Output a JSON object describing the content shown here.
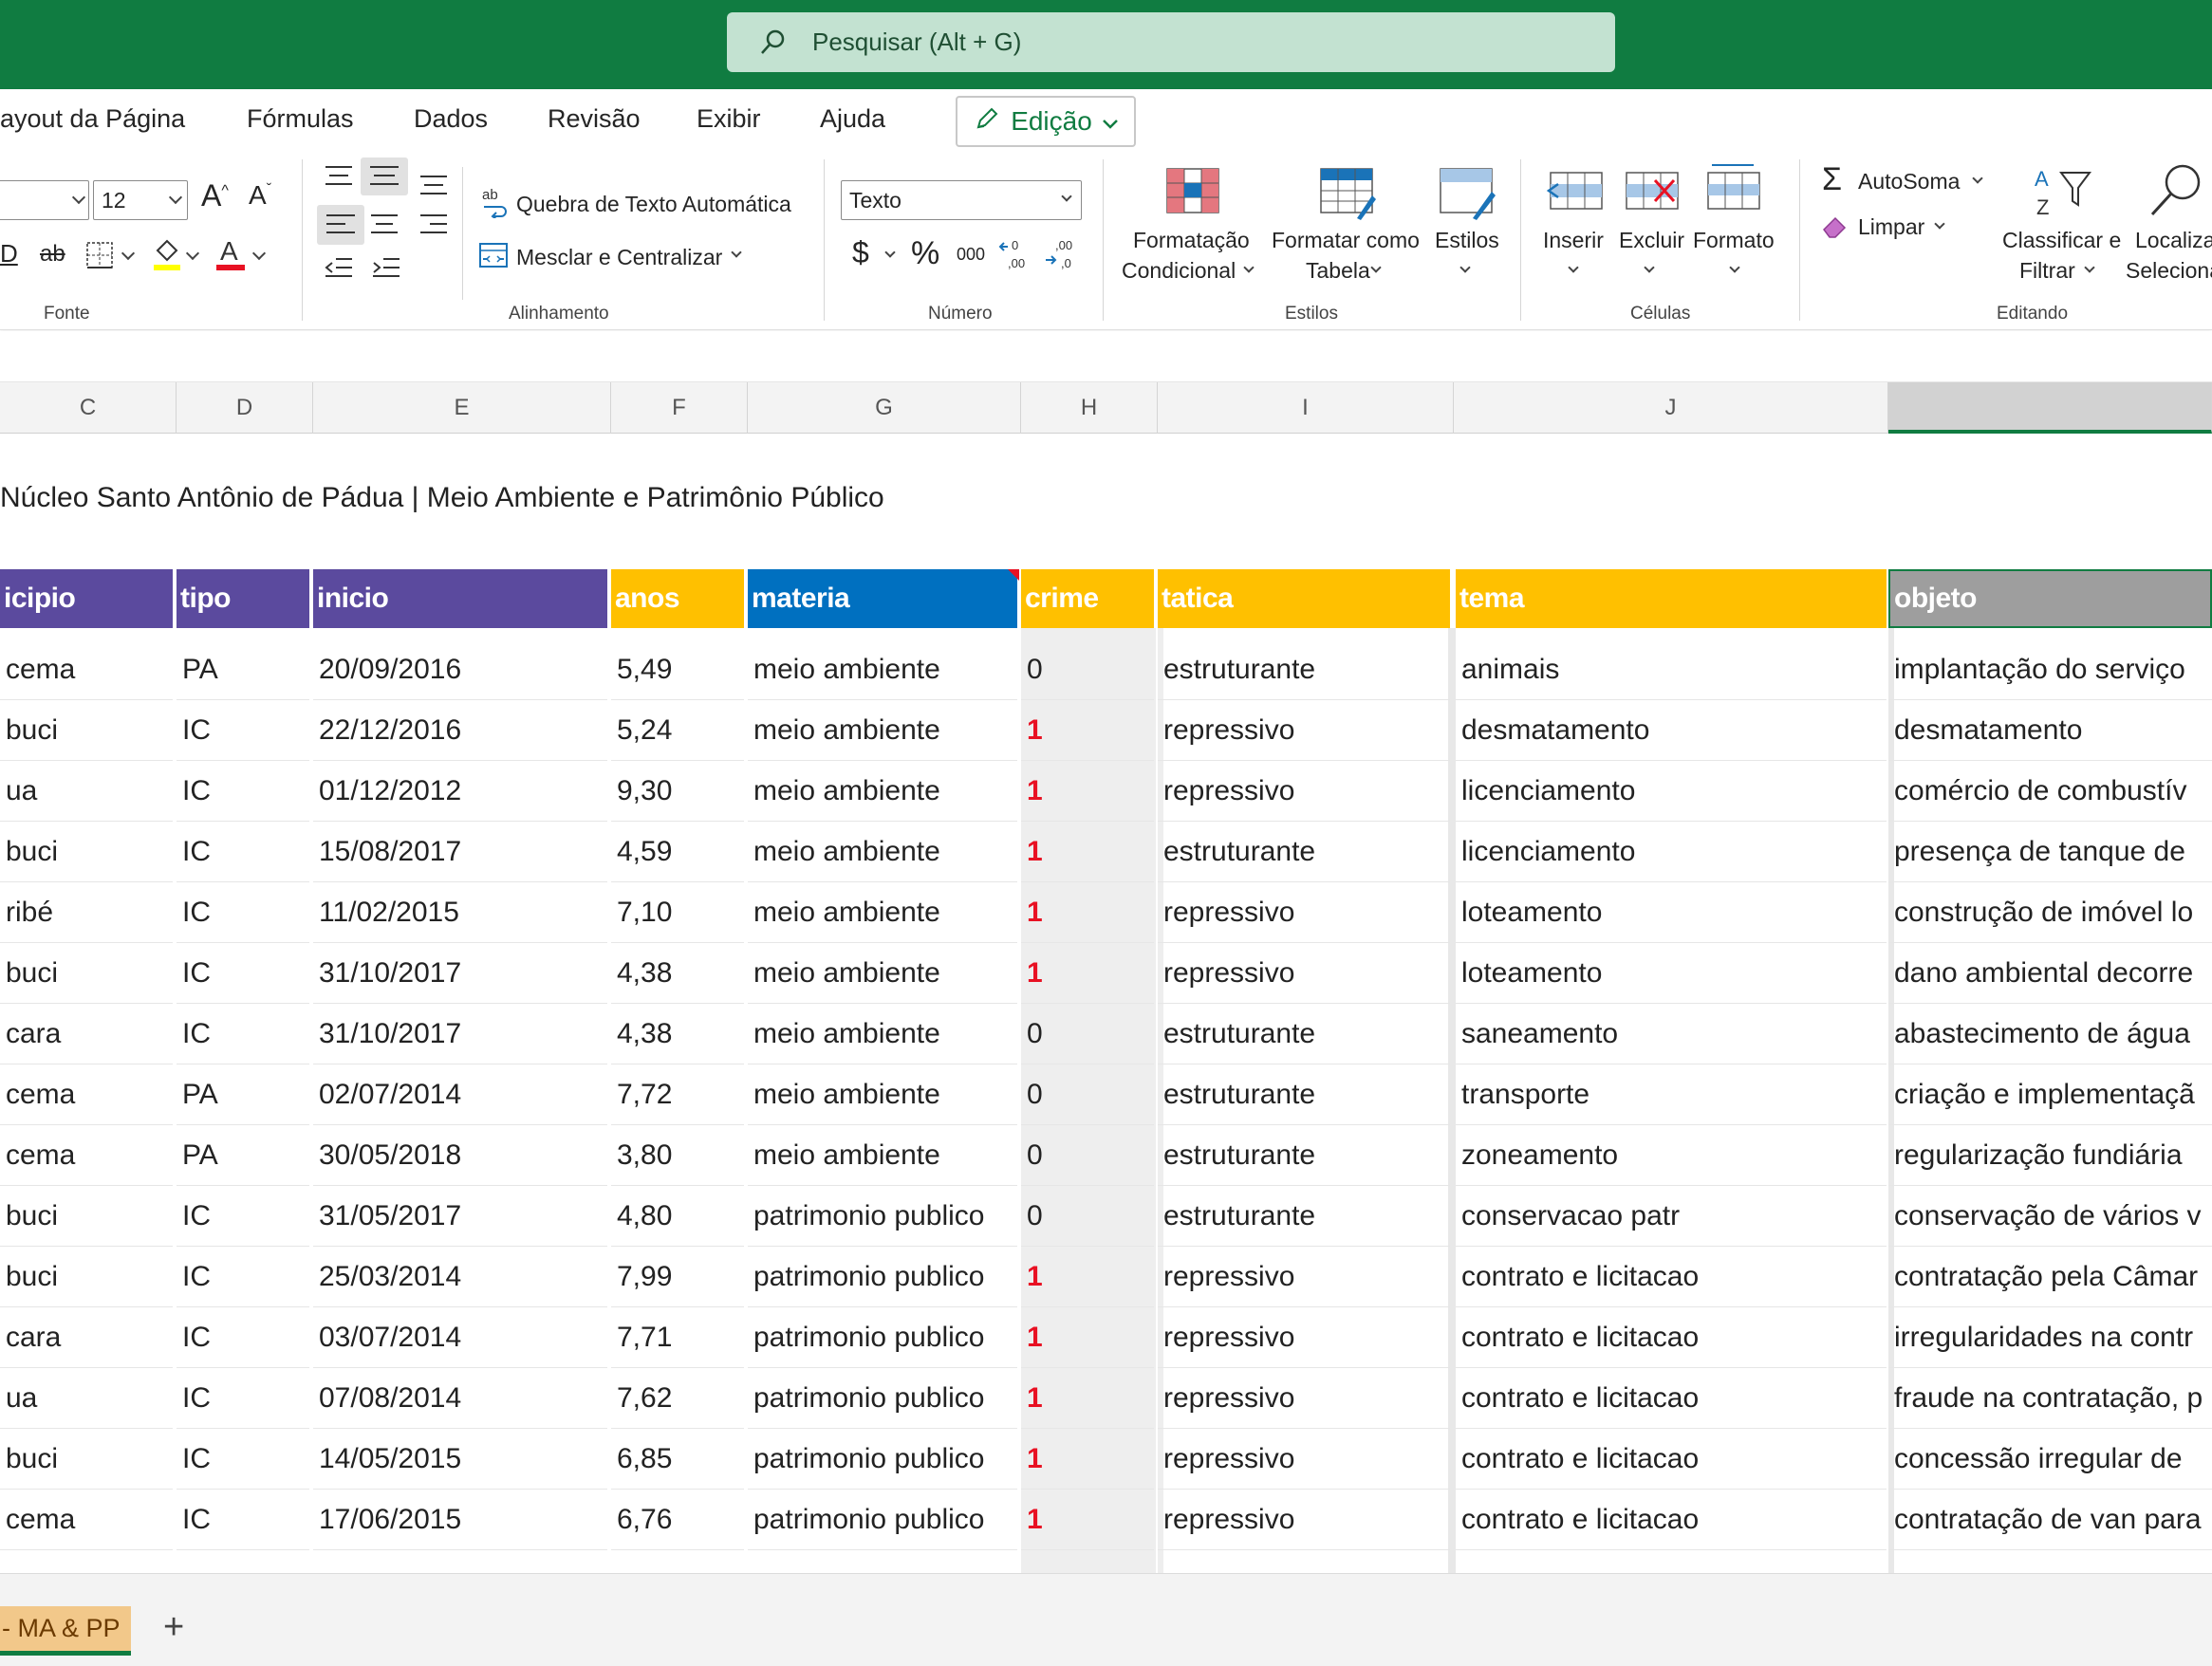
{
  "search": {
    "placeholder": "Pesquisar (Alt + G)"
  },
  "menu": {
    "items": [
      "ayout da Página",
      "Fórmulas",
      "Dados",
      "Revisão",
      "Exibir",
      "Ajuda"
    ],
    "mode_label": "Edição"
  },
  "ribbon": {
    "font": {
      "size": "12",
      "label": "Fonte",
      "grow_glyph": "A^",
      "shrink_glyph": "Aˇ"
    },
    "alignment": {
      "wrap_label": "Quebra de Texto Automática",
      "merge_label": "Mesclar e Centralizar",
      "label": "Alinhamento"
    },
    "number": {
      "format": "Texto",
      "currency": "$",
      "percent": "%",
      "thousands": "000",
      "label": "Número"
    },
    "styles": {
      "conditional_line1": "Formatação",
      "conditional_line2": "Condicional",
      "table_line1": "Formatar como",
      "table_line2": "Tabela",
      "styles": "Estilos",
      "label": "Estilos"
    },
    "cells": {
      "insert": "Inserir",
      "delete": "Excluir",
      "format": "Formato",
      "label": "Células"
    },
    "editing": {
      "autosum": "AutoSoma",
      "clear": "Limpar",
      "sort_line1": "Classificar e",
      "sort_line2": "Filtrar",
      "find_line1": "Localiza",
      "find_line2": "Seleciona",
      "label": "Editando"
    }
  },
  "columns": [
    "C",
    "D",
    "E",
    "F",
    "G",
    "H",
    "I",
    "J"
  ],
  "sheet_title": "Núcleo Santo Antônio de Pádua |  Meio Ambiente e Patrimônio Público",
  "headers": {
    "municipio": "icipio",
    "tipo": "tipo",
    "inicio": "inicio",
    "anos": "anos",
    "materia": "materia",
    "crime": "crime",
    "tatica": "tatica",
    "tema": "tema",
    "objeto": "objeto"
  },
  "header_colors": {
    "purple": "#5b4a9e",
    "yellow": "#ffc000",
    "blue": "#0070c0",
    "grey": "#9e9e9e"
  },
  "rows": [
    [
      "cema",
      "PA",
      "20/09/2016",
      "5,49",
      "meio ambiente",
      "0",
      "estruturante",
      "animais",
      "implantação do serviço"
    ],
    [
      "buci",
      "IC",
      "22/12/2016",
      "5,24",
      "meio ambiente",
      "1",
      "repressivo",
      "desmatamento",
      "desmatamento"
    ],
    [
      "ua",
      "IC",
      "01/12/2012",
      "9,30",
      "meio ambiente",
      "1",
      "repressivo",
      "licenciamento",
      "comércio de combustív"
    ],
    [
      "buci",
      "IC",
      "15/08/2017",
      "4,59",
      "meio ambiente",
      "1",
      "estruturante",
      "licenciamento",
      "presença de tanque de"
    ],
    [
      "ribé",
      "IC",
      "11/02/2015",
      "7,10",
      "meio ambiente",
      "1",
      "repressivo",
      "loteamento",
      "construção de imóvel lo"
    ],
    [
      "buci",
      "IC",
      "31/10/2017",
      "4,38",
      "meio ambiente",
      "1",
      "repressivo",
      "loteamento",
      "dano ambiental decorre"
    ],
    [
      "cara",
      "IC",
      "31/10/2017",
      "4,38",
      "meio ambiente",
      "0",
      "estruturante",
      "saneamento",
      "abastecimento de água"
    ],
    [
      "cema",
      "PA",
      "02/07/2014",
      "7,72",
      "meio ambiente",
      "0",
      "estruturante",
      "transporte",
      "criação e implementaçã"
    ],
    [
      "cema",
      "PA",
      "30/05/2018",
      "3,80",
      "meio ambiente",
      "0",
      "estruturante",
      "zoneamento",
      "regularização fundiária"
    ],
    [
      "buci",
      "IC",
      "31/05/2017",
      "4,80",
      "patrimonio publico",
      "0",
      "estruturante",
      "conservacao patr",
      "conservação de vários v"
    ],
    [
      "buci",
      "IC",
      "25/03/2014",
      "7,99",
      "patrimonio publico",
      "1",
      "repressivo",
      "contrato e licitacao",
      "contratação pela Câmar"
    ],
    [
      "cara",
      "IC",
      "03/07/2014",
      "7,71",
      "patrimonio publico",
      "1",
      "repressivo",
      "contrato e licitacao",
      "irregularidades na contr"
    ],
    [
      "ua",
      "IC",
      "07/08/2014",
      "7,62",
      "patrimonio publico",
      "1",
      "repressivo",
      "contrato e licitacao",
      "fraude na contratação, p"
    ],
    [
      "buci",
      "IC",
      "14/05/2015",
      "6,85",
      "patrimonio publico",
      "1",
      "repressivo",
      "contrato e licitacao",
      "concessão irregular de"
    ],
    [
      "cema",
      "IC",
      "17/06/2015",
      "6,76",
      "patrimonio publico",
      "1",
      "repressivo",
      "contrato e licitacao",
      "contratação de van para"
    ]
  ],
  "sheet_tab": "- MA & PP",
  "add_sheet": "+"
}
